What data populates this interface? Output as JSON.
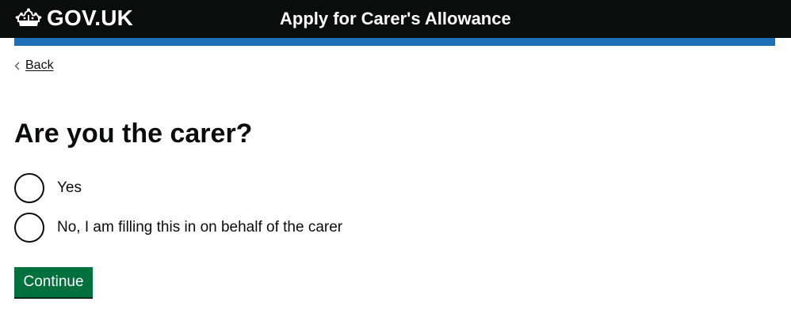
{
  "header": {
    "logo_text": "GOV.UK",
    "service_name": "Apply for Carer's Allowance"
  },
  "nav": {
    "back_label": "Back"
  },
  "question": {
    "heading": "Are you the carer?",
    "options": [
      {
        "label": "Yes",
        "selected": false
      },
      {
        "label": "No, I am filling this in on behalf of the carer",
        "selected": false
      }
    ]
  },
  "actions": {
    "continue_label": "Continue"
  },
  "colors": {
    "header_bg": "#0b0c0c",
    "brand_bar": "#1d70b8",
    "button_bg": "#00703c",
    "text": "#0b0c0c"
  },
  "icons": {
    "logo": "crown-icon",
    "back": "chevron-left-icon"
  }
}
